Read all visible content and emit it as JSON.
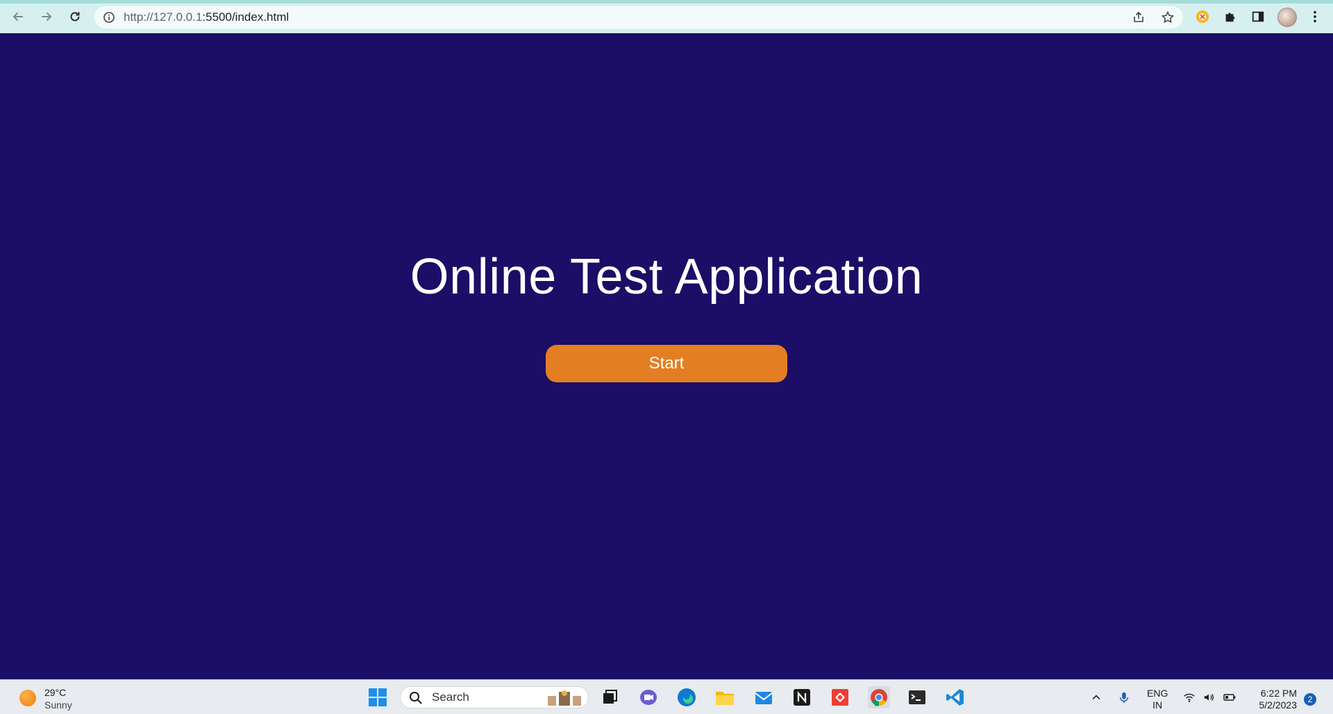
{
  "browser": {
    "url_host": "http://127.0.0.1",
    "url_rest": ":5500/index.html"
  },
  "page": {
    "title": "Online Test Application",
    "start_label": "Start",
    "background_color": "#1c0d66",
    "button_color": "#e47e22"
  },
  "taskbar": {
    "weather": {
      "temp": "29°C",
      "condition": "Sunny"
    },
    "search_label": "Search",
    "apps": [
      "windows-start-icon",
      "task-view-icon",
      "teams-chat-icon",
      "edge-icon",
      "file-explorer-icon",
      "mail-icon",
      "notion-icon",
      "anydesk-icon",
      "chrome-icon",
      "terminal-icon",
      "vscode-icon"
    ],
    "language_line1": "ENG",
    "language_line2": "IN",
    "time": "6:22 PM",
    "date": "5/2/2023",
    "notification_count": "2"
  }
}
